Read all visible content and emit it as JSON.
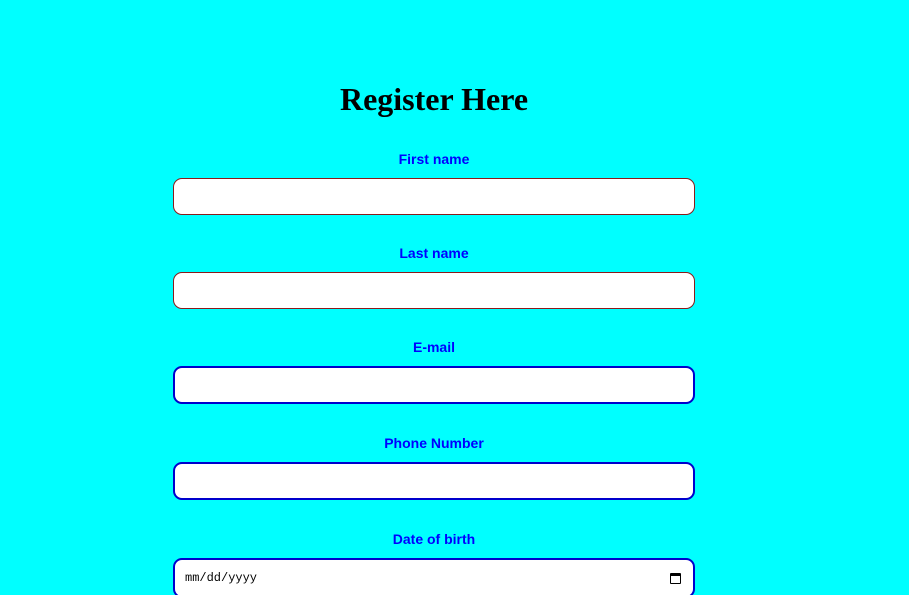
{
  "form": {
    "title": "Register Here",
    "fields": [
      {
        "label": "First name",
        "value": ""
      },
      {
        "label": "Last name",
        "value": ""
      },
      {
        "label": "E-mail",
        "value": ""
      },
      {
        "label": "Phone Number",
        "value": ""
      },
      {
        "label": "Date of birth",
        "placeholder": "mm/dd/yyyy",
        "icon": "calendar-icon"
      }
    ]
  },
  "colors": {
    "background": "#00ffff",
    "label": "#0000ff",
    "border_thin": "#8b1a1a",
    "border_thick": "#0000cc"
  }
}
